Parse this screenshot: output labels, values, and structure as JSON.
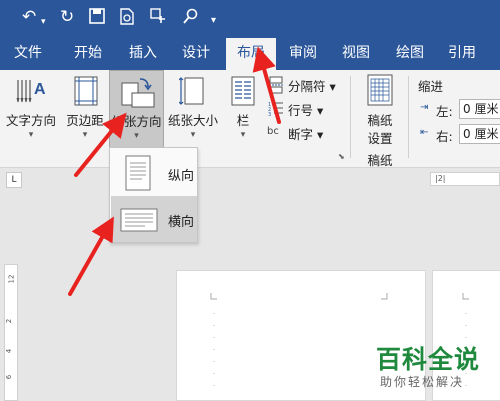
{
  "tabs": [
    "文件",
    "开始",
    "插入",
    "设计",
    "布局",
    "审阅",
    "视图",
    "绘图",
    "引用"
  ],
  "active_tab": "布局",
  "ribbon": {
    "text_direction": "文字方向",
    "margins": "页边距",
    "orientation": "纸张方向",
    "size": "纸张大小",
    "columns": "栏",
    "breaks": "分隔符",
    "line_numbers": "行号",
    "hyphenation": "断字",
    "hyphen_glyph": "bc",
    "manuscript_settings_line1": "稿纸",
    "manuscript_settings_line2": "设置",
    "manuscript_group": "稿纸",
    "indent_title": "缩进",
    "indent_left_label": "左:",
    "indent_left_value": "0 厘米",
    "indent_right_label": "右:",
    "indent_right_value": "0 厘米"
  },
  "orientation_menu": {
    "portrait": "纵向",
    "landscape": "横向",
    "selected": "横向"
  },
  "rulers": {
    "horizontal": "|2|",
    "vertical": [
      "12",
      "2",
      "4",
      "6"
    ]
  },
  "watermark": {
    "main": "百科全说",
    "sub": "助你轻松解决"
  },
  "colors": {
    "accent": "#2b579a",
    "arrow": "#e8231f",
    "watermark_green": "#1f8a3e"
  }
}
